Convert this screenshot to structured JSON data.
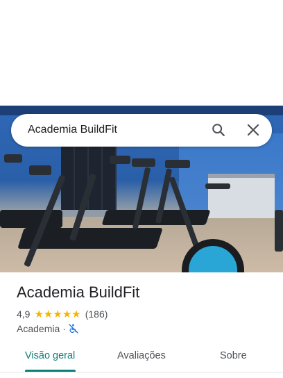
{
  "search": {
    "value": "Academia BuildFit",
    "search_icon": "search-icon",
    "close_icon": "close-icon"
  },
  "place": {
    "name": "Academia BuildFit",
    "rating": "4,9",
    "rating_stars": 5,
    "review_count": "(186)",
    "category": "Academia",
    "separator": "·",
    "accessibility_icon": "not-wheelchair-accessible-icon"
  },
  "tabs": [
    {
      "label": "Visão geral",
      "active": true
    },
    {
      "label": "Avaliações",
      "active": false
    },
    {
      "label": "Sobre",
      "active": false
    }
  ],
  "colors": {
    "accent": "#0b7f7a",
    "star": "#f6b400",
    "access_icon": "#1a73e8"
  }
}
